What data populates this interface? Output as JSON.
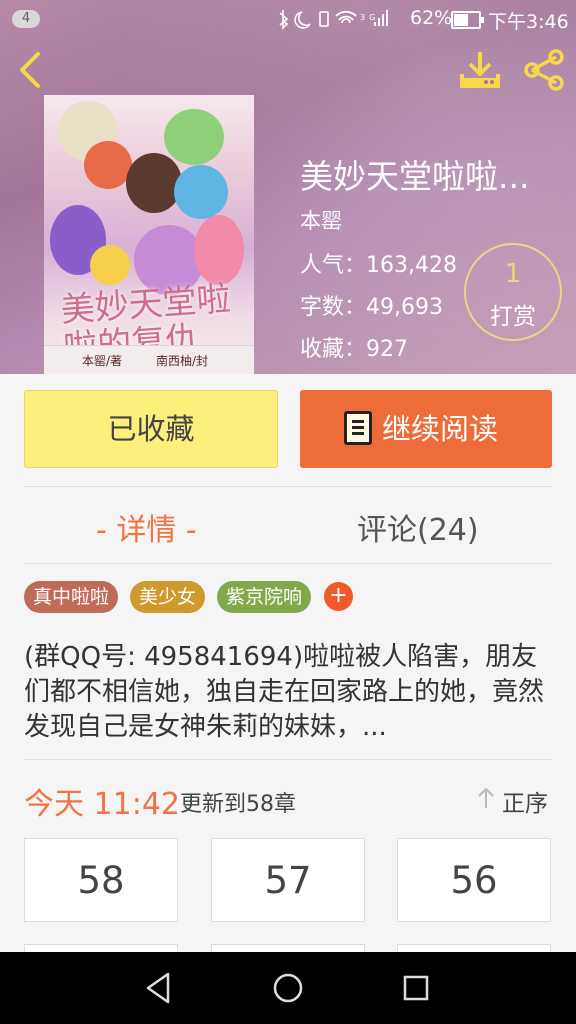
{
  "status_bar": {
    "notification_count": "4",
    "battery_percent": "62%",
    "time": "下午3:46",
    "icons": [
      "bluetooth-icon",
      "moon-icon",
      "vibrate-icon",
      "wifi-icon",
      "signal-icon",
      "battery-icon"
    ],
    "signal_label": "3G"
  },
  "header": {
    "icons": [
      "back-icon",
      "download-icon",
      "share-icon"
    ],
    "background_color": "#a27598"
  },
  "cover": {
    "title_art": "美妙天堂啦啦的复仇",
    "author_credit": "本罂/著",
    "artist_credit": "南西柚/封"
  },
  "book": {
    "title": "美妙天堂啦啦...",
    "author": "本罂",
    "popularity": "人气：163,428",
    "word_count": "字数：49,693",
    "favorites": "收藏：927"
  },
  "tip": {
    "count": "1",
    "label": "打赏"
  },
  "actions": {
    "favorite_label": "已收藏",
    "read_label": "继续阅读",
    "favorite_color": "#fbf07c",
    "read_color": "#ee6b3a"
  },
  "tabs": {
    "detail": "- 详情 -",
    "comments": "评论(24)",
    "active_color": "#ef7444"
  },
  "tags": [
    {
      "label": "真中啦啦",
      "color": "#c06a58"
    },
    {
      "label": "美少女",
      "color": "#cf9a2c"
    },
    {
      "label": "紫京院响",
      "color": "#82a84a"
    }
  ],
  "tag_add_label": "+",
  "description": "(群QQ号: 495841694)啦啦被人陷害，朋友们都不相信她，独自走在回家路上的她，竟然发现自己是女神朱莉的妹妹，...",
  "update": {
    "time": "今天 11:42",
    "text": "更新到58章",
    "sort_label": "正序"
  },
  "chapters": [
    "58",
    "57",
    "56"
  ],
  "nav_bar": {
    "icons": [
      "back-triangle-icon",
      "home-circle-icon",
      "recents-square-icon"
    ]
  }
}
